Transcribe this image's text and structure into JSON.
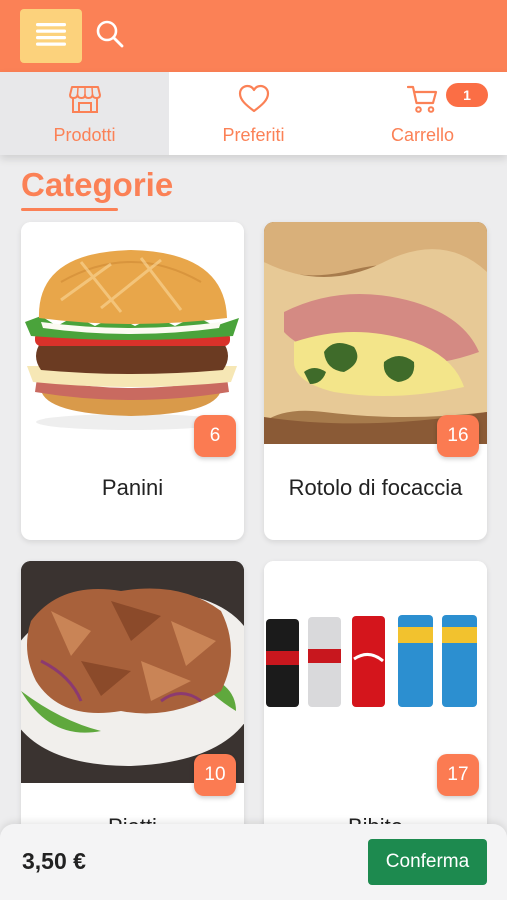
{
  "header": {
    "menu_icon": "hamburger-menu-icon",
    "search_icon": "search-icon",
    "accent_color": "#fb8156"
  },
  "tabs": [
    {
      "label": "Prodotti",
      "icon": "store-icon",
      "active": true
    },
    {
      "label": "Preferiti",
      "icon": "heart-icon",
      "active": false
    },
    {
      "label": "Carrello",
      "icon": "cart-icon",
      "active": false,
      "badge": "1"
    }
  ],
  "section": {
    "title": "Categorie"
  },
  "categories": [
    {
      "name": "Panini",
      "count": "6",
      "image": "burger-photo"
    },
    {
      "name": "Rotolo di focaccia",
      "count": "16",
      "image": "focaccia-roll-photo"
    },
    {
      "name": "Piatti",
      "count": "10",
      "image": "kebab-plate-photo"
    },
    {
      "name": "Bibite",
      "count": "17",
      "image": "soda-cans-photo"
    }
  ],
  "footer": {
    "total": "3,50 €",
    "confirm_label": "Conferma",
    "confirm_color": "#1d8a4f"
  }
}
